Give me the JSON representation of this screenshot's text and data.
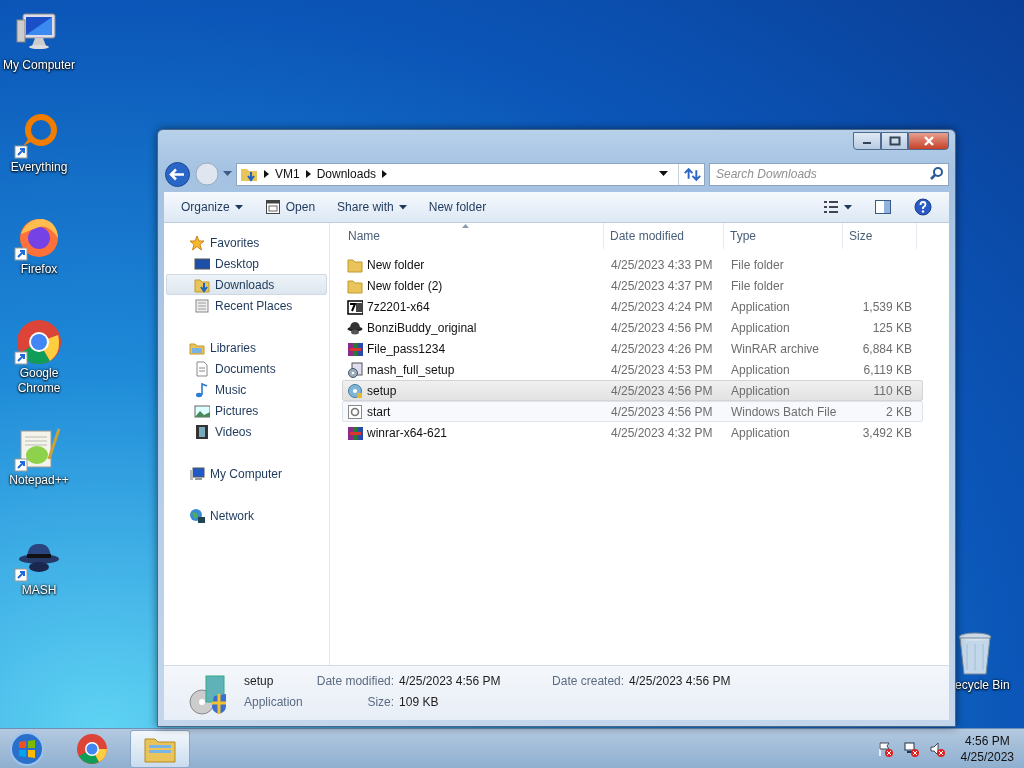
{
  "desktop_icons": [
    {
      "label": "My Computer",
      "kind": "computer",
      "shortcut": false
    },
    {
      "label": "Everything",
      "kind": "everything",
      "shortcut": true
    },
    {
      "label": "Firefox",
      "kind": "firefox",
      "shortcut": true
    },
    {
      "label": "Google Chrome",
      "kind": "chrome",
      "shortcut": true
    },
    {
      "label": "Notepad++",
      "kind": "notepad",
      "shortcut": true
    },
    {
      "label": "MASH",
      "kind": "hat",
      "shortcut": true
    },
    {
      "label": "ecycle Bin",
      "kind": "bin",
      "shortcut": false
    }
  ],
  "window": {
    "address": [
      "VM1",
      "Downloads"
    ],
    "search": {
      "placeholder": "Search Downloads"
    },
    "toolbar": [
      {
        "label": "Organize",
        "kind": "menu"
      },
      {
        "label": "Open",
        "kind": "icon"
      },
      {
        "label": "Share with",
        "kind": "menu"
      },
      {
        "label": "New folder",
        "kind": "plain"
      }
    ]
  },
  "sidebar": [
    {
      "label": "Favorites",
      "kind": "star",
      "selected": false,
      "children": [
        {
          "label": "Desktop",
          "kind": "desktop",
          "selected": false
        },
        {
          "label": "Downloads",
          "kind": "downloads",
          "selected": true
        },
        {
          "label": "Recent Places",
          "kind": "recent",
          "selected": false
        }
      ]
    },
    {
      "label": "Libraries",
      "kind": "libraries",
      "selected": false,
      "children": [
        {
          "label": "Documents",
          "kind": "documents",
          "selected": false
        },
        {
          "label": "Music",
          "kind": "music",
          "selected": false
        },
        {
          "label": "Pictures",
          "kind": "pictures",
          "selected": false
        },
        {
          "label": "Videos",
          "kind": "videos",
          "selected": false
        }
      ]
    },
    {
      "label": "My Computer",
      "kind": "computer",
      "selected": false
    },
    {
      "label": "Network",
      "kind": "network",
      "selected": false
    }
  ],
  "columns": [
    "Name",
    "Date modified",
    "Type",
    "Size"
  ],
  "files": [
    {
      "name": "New folder",
      "kind": "folder",
      "date": "4/25/2023 4:33 PM",
      "type": "File folder",
      "selected": false,
      "hovered": false
    },
    {
      "name": "New folder (2)",
      "kind": "folder",
      "date": "4/25/2023 4:37 PM",
      "type": "File folder",
      "selected": false,
      "hovered": false
    },
    {
      "name": "7z2201-x64",
      "kind": "sevenzip",
      "date": "4/25/2023 4:24 PM",
      "type": "Application",
      "size": "1,539 KB",
      "selected": false,
      "hovered": false
    },
    {
      "name": "BonziBuddy_original",
      "kind": "hat",
      "date": "4/25/2023 4:56 PM",
      "type": "Application",
      "size": "125 KB",
      "selected": false,
      "hovered": false
    },
    {
      "name": "File_pass1234",
      "kind": "rar",
      "date": "4/25/2023 4:26 PM",
      "type": "WinRAR archive",
      "size": "6,884 KB",
      "selected": false,
      "hovered": false
    },
    {
      "name": "mash_full_setup",
      "kind": "installer",
      "date": "4/25/2023 4:53 PM",
      "type": "Application",
      "size": "6,119 KB",
      "selected": false,
      "hovered": false
    },
    {
      "name": "setup",
      "kind": "setup",
      "date": "4/25/2023 4:56 PM",
      "type": "Application",
      "size": "110 KB",
      "selected": true,
      "hovered": false
    },
    {
      "name": "start",
      "kind": "batch",
      "date": "4/25/2023 4:56 PM",
      "type": "Windows Batch File",
      "size": "2 KB",
      "selected": false,
      "hovered": true
    },
    {
      "name": "winrar-x64-621",
      "kind": "rar",
      "date": "4/25/2023 4:32 PM",
      "type": "Application",
      "size": "3,492 KB",
      "selected": false,
      "hovered": false
    }
  ],
  "details": {
    "name": "setup",
    "type": "Application",
    "fields": [
      {
        "label": "Date modified:",
        "value": "4/25/2023 4:56 PM"
      },
      {
        "label": "Date created:",
        "value": "4/25/2023 4:56 PM"
      },
      {
        "label": "Size:",
        "value": "109 KB"
      }
    ]
  },
  "taskbar": {
    "apps": [
      {
        "kind": "chrome",
        "selected": false
      },
      {
        "kind": "explorer",
        "selected": true
      }
    ],
    "clock": {
      "time": "4:56 PM",
      "date": "4/25/2023"
    }
  }
}
